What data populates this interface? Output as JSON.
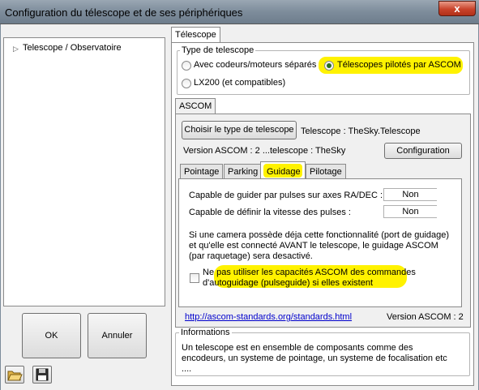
{
  "window": {
    "title": "Configuration du télescope et de ses périphériques",
    "close_glyph": "x"
  },
  "tree": {
    "items": [
      {
        "label": "Telescope / Observatoire"
      }
    ]
  },
  "buttons": {
    "ok": "OK",
    "cancel": "Annuler"
  },
  "icons": {
    "open": "folder-open-icon",
    "save": "floppy-disk-icon"
  },
  "main_tab": {
    "label": "Télescope"
  },
  "type_group": {
    "legend": "Type de telescope",
    "options": [
      {
        "label": "Avec codeurs/moteurs séparés",
        "selected": false
      },
      {
        "label": "Télescopes pilotés par ASCOM",
        "selected": true
      },
      {
        "label": "LX200 (et compatibles)",
        "selected": false
      }
    ]
  },
  "ascom_tab": {
    "label": "ASCOM"
  },
  "ascom": {
    "choose_button": "Choisir le type de telescope",
    "telescope_label": "Telescope :  TheSky.Telescope",
    "version_label": "Version ASCOM : 2 ...telescope : TheSky",
    "config_button": "Configuration"
  },
  "sub_tabs": [
    {
      "label": "Pointage",
      "active": false
    },
    {
      "label": "Parking",
      "active": false
    },
    {
      "label": "Guidage",
      "active": true
    },
    {
      "label": "Pilotage",
      "active": false
    }
  ],
  "guidage": {
    "pulse_guide_label": "Capable de guider par pulses  sur axes RA/DEC :",
    "pulse_guide_value": "Non",
    "pulse_rate_label": "Capable de définir la vitesse des pulses :",
    "pulse_rate_value": "Non",
    "note_lines": [
      "Si une camera possède déja cette fonctionnalité (port de guidage)",
      "et qu'elle est connecté AVANT le telescope, le guidage ASCOM",
      "(par raquetage) sera desactivé."
    ],
    "checkbox_line1_plain": "Ne ",
    "checkbox_line1_highlight": "pas utiliser les capacités ASCOM des commandes",
    "checkbox_line2": "d'autoguidage (pulseguide) si elles existent",
    "checkbox_checked": false
  },
  "footer": {
    "link": "http://ascom-standards.org/standards.html",
    "version": "Version ASCOM : 2"
  },
  "info": {
    "legend": "Informations",
    "lines": [
      "Un telescope est en ensemble de composants comme des",
      "encodeurs, un systeme de pointage, un systeme de focalisation etc",
      "...."
    ]
  },
  "colors": {
    "highlight": "#fff200",
    "link": "#0000cc",
    "titlebar": "#7d8c9b",
    "close": "#c9432b"
  }
}
